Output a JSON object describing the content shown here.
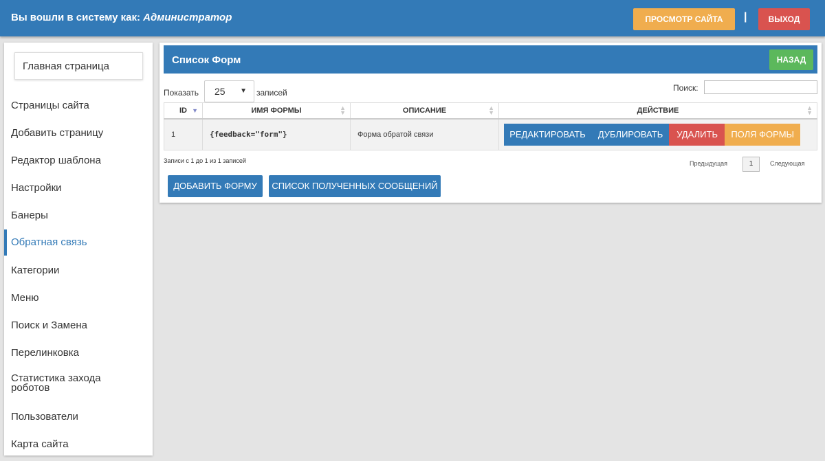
{
  "header": {
    "logged_in_prefix": "Вы вошли в систему как:",
    "user_role": "Администратор",
    "view_site_label": "ПРОСМОТР САЙТА",
    "separator": "|",
    "logout_label": "ВЫХОД"
  },
  "sidebar": {
    "home_label": "Главная страница",
    "items": [
      {
        "label": "Страницы сайта",
        "active": false
      },
      {
        "label": "Добавить страницу",
        "active": false
      },
      {
        "label": "Редактор шаблона",
        "active": false
      },
      {
        "label": "Настройки",
        "active": false
      },
      {
        "label": "Банеры",
        "active": false
      },
      {
        "label": "Обратная связь",
        "active": true
      },
      {
        "label": "Категории",
        "active": false
      },
      {
        "label": "Меню",
        "active": false
      },
      {
        "label": "Поиск и Замена",
        "active": false
      },
      {
        "label": "Перелинковка",
        "active": false
      },
      {
        "label": "Статистика захода роботов",
        "active": false
      },
      {
        "label": "Пользователи",
        "active": false
      },
      {
        "label": "Карта сайта",
        "active": false
      }
    ]
  },
  "panel": {
    "title": "Список Форм",
    "back_label": "НАЗАД",
    "show_label": "Показать",
    "page_size": "25",
    "records_label": "записей",
    "search_label": "Поиск:",
    "search_value": "",
    "columns": [
      "ID",
      "ИМЯ ФОРМЫ",
      "ОПИСАНИЕ",
      "ДЕЙСТВИЕ"
    ],
    "rows": [
      {
        "id": "1",
        "name": "{feedback=\"form\"}",
        "description": "Форма обратой связи",
        "actions": [
          "РЕДАКТИРОВАТЬ",
          "ДУБЛИРОВАТЬ",
          "УДАЛИТЬ",
          "ПОЛЯ ФОРМЫ"
        ]
      }
    ],
    "info": "Записи с 1 до 1 из 1 записей",
    "prev_label": "Предыдущая",
    "current_page": "1",
    "next_label": "Следующая",
    "add_form_label": "ДОБАВИТЬ ФОРМУ",
    "messages_label": "СПИСОК ПОЛУЧЕННЫХ СООБЩЕНИЙ"
  },
  "colors": {
    "primary": "#337ab7",
    "warning": "#f0ad4e",
    "danger": "#d9534f",
    "success": "#5cb85c"
  }
}
